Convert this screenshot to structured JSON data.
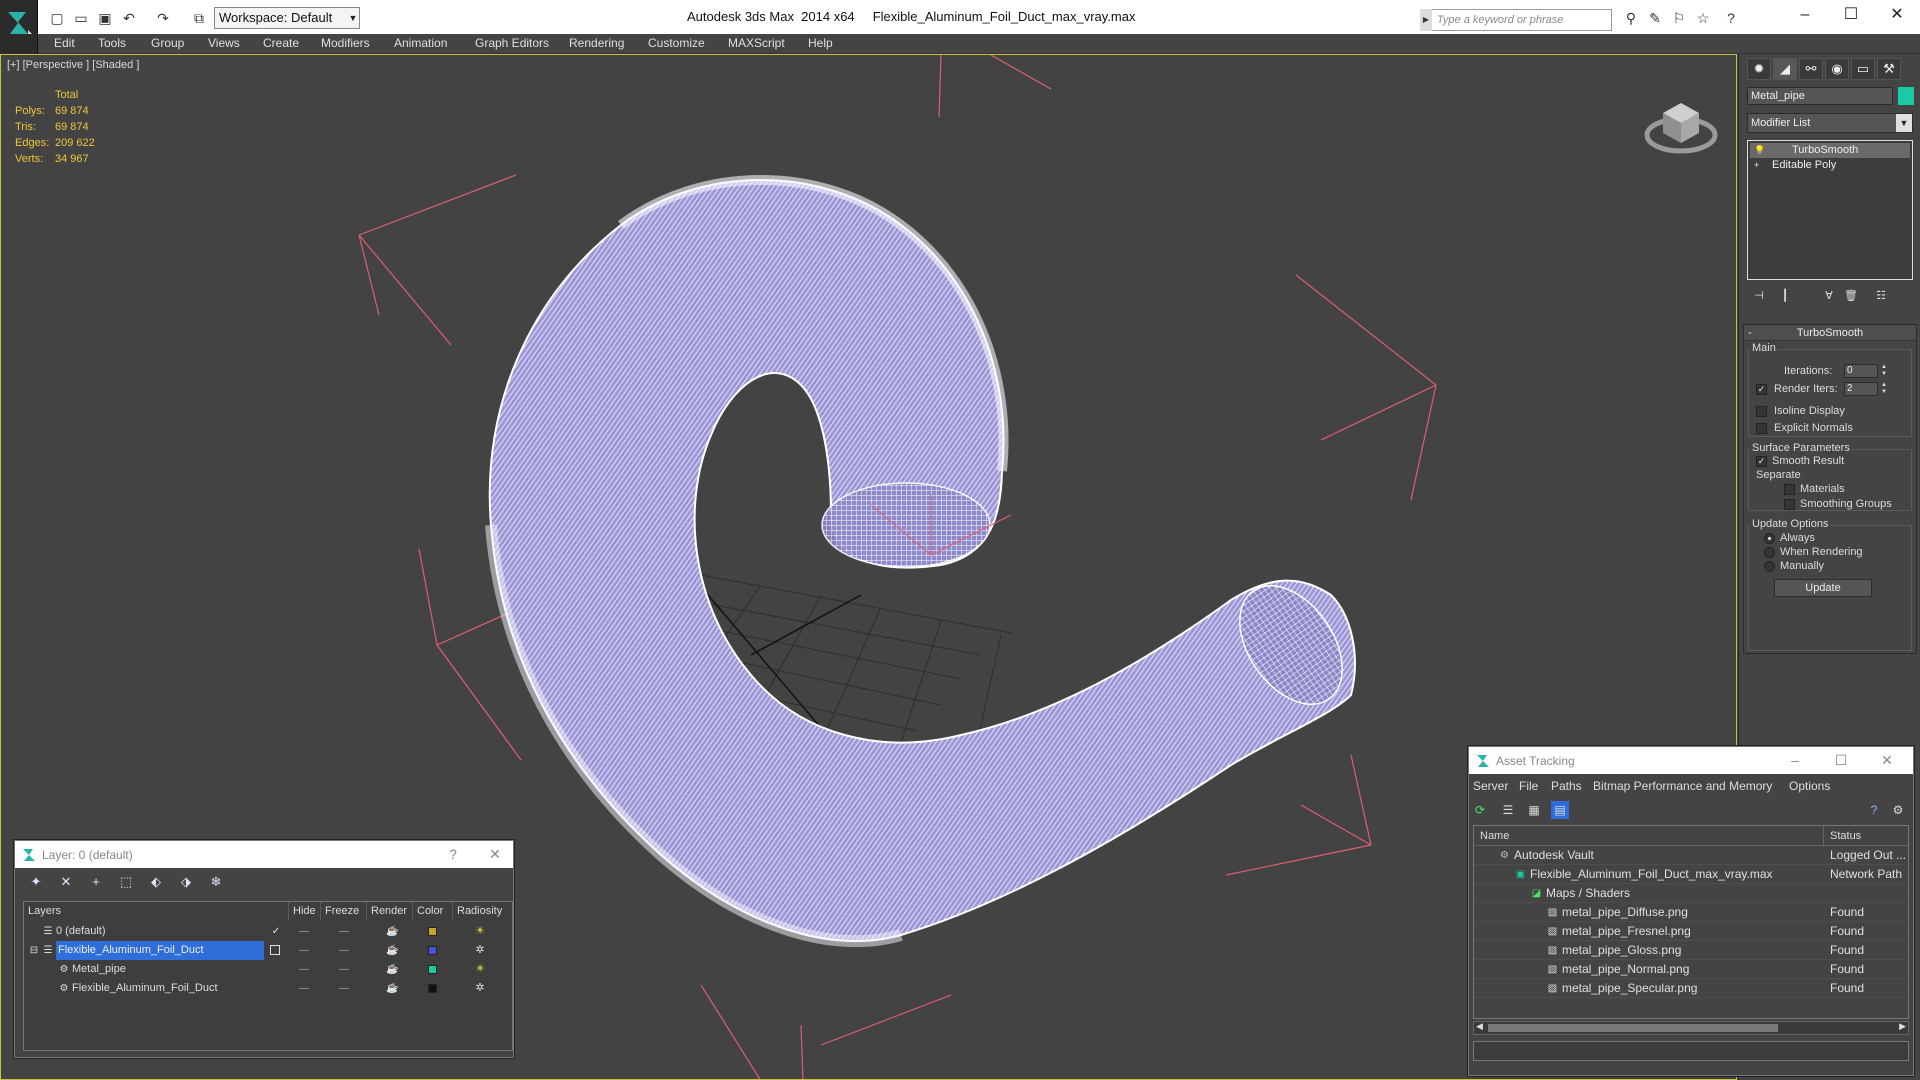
{
  "app": {
    "title": "Autodesk 3ds Max  2014 x64     Flexible_Aluminum_Foil_Duct_max_vray.max",
    "workspace": "Workspace: Default",
    "search_placeholder": "Type a keyword or phrase"
  },
  "menu": [
    "Edit",
    "Tools",
    "Group",
    "Views",
    "Create",
    "Modifiers",
    "Animation",
    "Graph Editors",
    "Rendering",
    "Customize",
    "MAXScript",
    "Help"
  ],
  "viewport": {
    "label": "[+] [Perspective ] [Shaded ]",
    "stats": {
      "header": "Total",
      "rows": [
        {
          "label": "Polys:",
          "value": "69 874"
        },
        {
          "label": "Tris:",
          "value": "69 874"
        },
        {
          "label": "Edges:",
          "value": "209 622"
        },
        {
          "label": "Verts:",
          "value": "34 967"
        }
      ]
    },
    "colors": {
      "stats": "#f0c73a",
      "wire": "#e8e4ff",
      "bbox": "#d9616e"
    }
  },
  "command_panel": {
    "object_name": "Metal_pipe",
    "object_color": "#1cc9a5",
    "modifier_list": "Modifier List",
    "stack": [
      "TurboSmooth",
      "Editable Poly"
    ],
    "rollout": {
      "title": "TurboSmooth",
      "main_group": "Main",
      "iterations_label": "Iterations:",
      "iterations_value": "0",
      "render_iters_label": "Render Iters:",
      "render_iters_value": "2",
      "isoline": "Isoline Display",
      "explicit_normals": "Explicit Normals",
      "surface_group": "Surface Parameters",
      "smooth_result": "Smooth Result",
      "separate": "Separate",
      "materials": "Materials",
      "smoothing_groups": "Smoothing Groups",
      "update_group": "Update Options",
      "always": "Always",
      "when_rendering": "When Rendering",
      "manually": "Manually",
      "update_button": "Update"
    }
  },
  "layer_panel": {
    "title": "Layer: 0 (default)",
    "help": "?",
    "columns": [
      "Layers",
      "Hide",
      "Freeze",
      "Render",
      "Color",
      "Radiosity"
    ],
    "rows": [
      {
        "name": "0 (default)",
        "color": "#c9a227",
        "selected": false
      },
      {
        "name": "Flexible_Aluminum_Foil_Duct",
        "color": "#4655d8",
        "selected": true
      },
      {
        "name": "Metal_pipe",
        "color": "#1cc9a5",
        "selected": false
      },
      {
        "name": "Flexible_Aluminum_Foil_Duct",
        "color": "#111111",
        "selected": false
      }
    ]
  },
  "asset_panel": {
    "title": "Asset Tracking",
    "menu": [
      "Server",
      "File",
      "Paths",
      "Bitmap Performance and Memory",
      "Options"
    ],
    "columns": [
      "Name",
      "Status"
    ],
    "rows": [
      {
        "name": "Autodesk Vault",
        "status": "Logged Out ..."
      },
      {
        "name": "Flexible_Aluminum_Foil_Duct_max_vray.max",
        "status": "Network Path"
      },
      {
        "name": "Maps / Shaders",
        "status": ""
      },
      {
        "name": "metal_pipe_Diffuse.png",
        "status": "Found"
      },
      {
        "name": "metal_pipe_Fresnel.png",
        "status": "Found"
      },
      {
        "name": "metal_pipe_Gloss.png",
        "status": "Found"
      },
      {
        "name": "metal_pipe_Normal.png",
        "status": "Found"
      },
      {
        "name": "metal_pipe_Specular.png",
        "status": "Found"
      }
    ]
  }
}
